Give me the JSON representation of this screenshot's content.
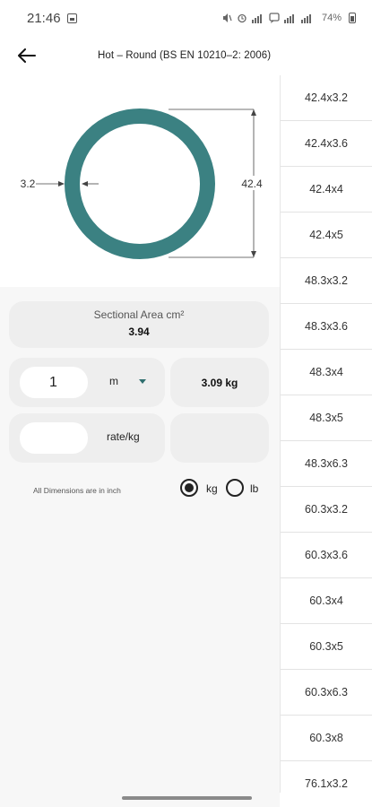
{
  "status_bar": {
    "time": "21:46",
    "battery": "74%"
  },
  "header": {
    "title": "Hot – Round (BS EN 10210–2: 2006)"
  },
  "drawing": {
    "thickness_label": "3.2",
    "diameter_label": "42.4",
    "ring_color": "#3b8182"
  },
  "sectional_area": {
    "label": "Sectional Area cm²",
    "value": "3.94"
  },
  "length": {
    "quantity": "1",
    "unit": "m",
    "weight": "3.09 kg"
  },
  "rate": {
    "placeholder": "",
    "label": "rate/kg",
    "cost": ""
  },
  "units": {
    "note": "All Dimensions are in inch",
    "kg_label": "kg",
    "lb_label": "lb",
    "selected": "kg"
  },
  "sizes": [
    "42.4x3.2",
    "42.4x3.6",
    "42.4x4",
    "42.4x5",
    "48.3x3.2",
    "48.3x3.6",
    "48.3x4",
    "48.3x5",
    "48.3x6.3",
    "60.3x3.2",
    "60.3x3.6",
    "60.3x4",
    "60.3x5",
    "60.3x6.3",
    "60.3x8",
    "76.1x3.2"
  ]
}
